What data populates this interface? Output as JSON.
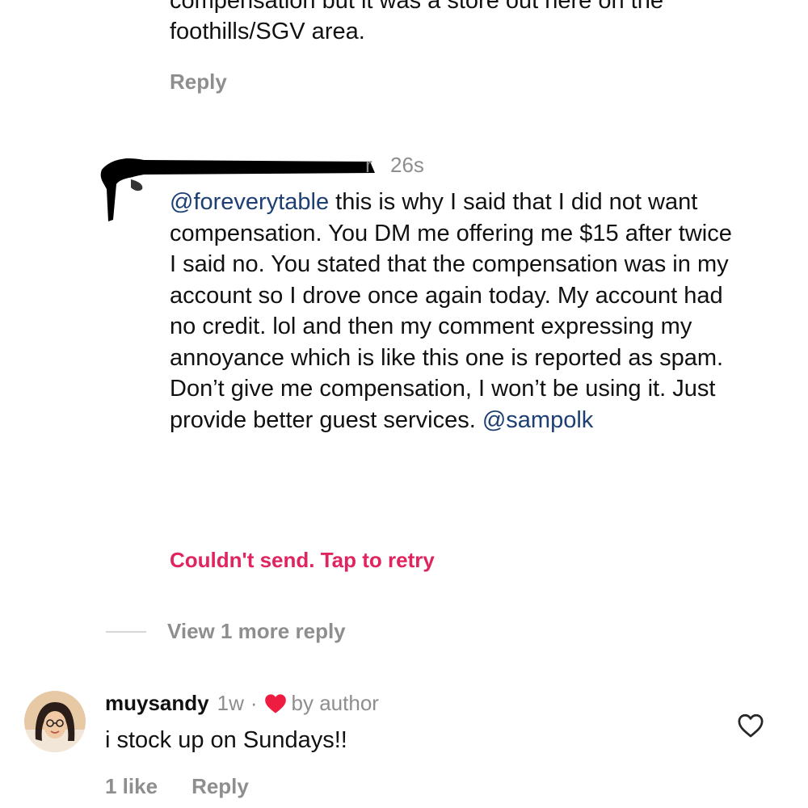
{
  "previous_comment": {
    "text": "compensation but it was a store out here on the foothills/SGV area.",
    "reply_label": "Reply"
  },
  "comment": {
    "username_visible_suffix": "r",
    "time": "26s",
    "mention_start": "@foreverytable",
    "body": " this is why I said that I did not want compensation.  You DM me offering me $15 after twice I said no.  You stated that the compensation was in my account so I drove once again today. My account had no credit. lol and then my comment expressing my annoyance which is like this one is reported as spam. Don’t give me compensation, I won’t be using it.  Just provide better guest services. ",
    "mention_end": "@sampolk",
    "error": "Couldn't send. Tap to retry"
  },
  "thread": {
    "view_more": "View 1 more reply"
  },
  "comment2": {
    "username": "muysandy",
    "time": "1w",
    "separator": "·",
    "liked_by_author": "by author",
    "text": "i stock up on Sundays!!",
    "likes": "1 like",
    "reply_label": "Reply"
  },
  "colors": {
    "mention": "#1d3f73",
    "error": "#e0245e",
    "heart": "#ed1c40",
    "muted": "#8e8e8e"
  },
  "icons": {
    "author_heart": "heart-filled-icon",
    "like_button": "heart-outline-icon"
  }
}
